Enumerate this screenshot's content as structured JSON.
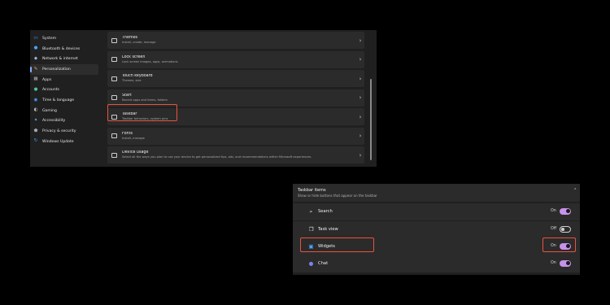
{
  "sidebar": {
    "items": [
      {
        "label": "System",
        "icon": "monitor-icon",
        "color": "#4aa3ff"
      },
      {
        "label": "Bluetooth & devices",
        "icon": "bluetooth-icon",
        "color": "#4aa3ff"
      },
      {
        "label": "Network & internet",
        "icon": "wifi-icon",
        "color": "#9fb8d9"
      },
      {
        "label": "Personalization",
        "icon": "brush-icon",
        "color": "#e0a868",
        "active": true
      },
      {
        "label": "Apps",
        "icon": "apps-icon",
        "color": "#b0b0b0"
      },
      {
        "label": "Accounts",
        "icon": "person-icon",
        "color": "#4fc3a1"
      },
      {
        "label": "Time & language",
        "icon": "globe-clock-icon",
        "color": "#4aa3ff"
      },
      {
        "label": "Gaming",
        "icon": "gamepad-icon",
        "color": "#c0c0c0"
      },
      {
        "label": "Accessibility",
        "icon": "accessibility-icon",
        "color": "#6cb4ff"
      },
      {
        "label": "Privacy & security",
        "icon": "shield-icon",
        "color": "#9fa9b8"
      },
      {
        "label": "Windows Update",
        "icon": "refresh-icon",
        "color": "#4aa3ff"
      }
    ]
  },
  "personalization": {
    "rows": [
      {
        "title": "Themes",
        "subtitle": "Install, create, manage",
        "icon": "themes-icon"
      },
      {
        "title": "Lock screen",
        "subtitle": "Lock screen images, apps, animations",
        "icon": "lock-screen-icon"
      },
      {
        "title": "Touch keyboard",
        "subtitle": "Themes, size",
        "icon": "keyboard-icon"
      },
      {
        "title": "Start",
        "subtitle": "Recent apps and items, folders",
        "icon": "start-icon"
      },
      {
        "title": "Taskbar",
        "subtitle": "Taskbar behaviors, system pins",
        "icon": "taskbar-icon"
      },
      {
        "title": "Fonts",
        "subtitle": "Install, manage",
        "icon": "fonts-icon"
      },
      {
        "title": "Device usage",
        "subtitle": "Select all the ways you plan to use your device to get personalized tips, ads, and recommendations within Microsoft experiences.",
        "icon": "device-usage-icon"
      }
    ]
  },
  "taskbar_items": {
    "title": "Taskbar items",
    "subtitle": "Show or hide buttons that appear on the taskbar",
    "items": [
      {
        "label": "Search",
        "state": "On",
        "on": true,
        "icon": "search-icon"
      },
      {
        "label": "Task view",
        "state": "Off",
        "on": false,
        "icon": "task-view-icon"
      },
      {
        "label": "Widgets",
        "state": "On",
        "on": true,
        "icon": "widgets-icon"
      },
      {
        "label": "Chat",
        "state": "On",
        "on": true,
        "icon": "chat-icon"
      }
    ]
  },
  "colors": {
    "accent": "#c792ea",
    "highlight": "#e8533d",
    "window": "#202020",
    "card": "#2b2b2b"
  }
}
